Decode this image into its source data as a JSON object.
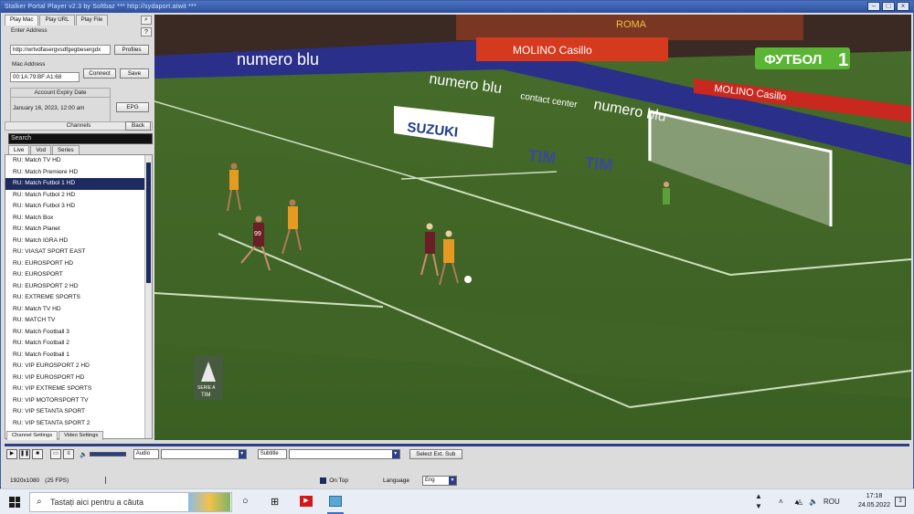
{
  "window": {
    "title": "Stalker Portal Player v2.3 by Soltbaz  ***  http://sydaport.atwit ***",
    "colors": {
      "accent": "#2c4f9c",
      "selection": "#1d2b5e"
    }
  },
  "left_panel": {
    "tabs": [
      "Play Mac",
      "Play URL",
      "Play File"
    ],
    "portal_label": "Enter Address",
    "portal_value": "http://wrtvdfasergvsdfgegbesergdx",
    "profiles_btn": "Profiles",
    "mac_label": "Mac Address",
    "mac_value": "00:1A:79:BF:A1:68",
    "connect_btn": "Connect",
    "save_btn": "Save",
    "expiry_label": "Account Expiry Date",
    "expiry_value": "January 16, 2023, 12:00 am",
    "epg_btn": "EPG",
    "channels_label": "Channels",
    "back_btn": "Back",
    "search_value": "Search",
    "content_tabs": [
      "Live",
      "Vod",
      "Series"
    ],
    "channels": [
      "RU: Match TV HD",
      "RU: Match Premiere HD",
      "RU: Match Futbol 1 HD",
      "RU: Match Futbol 2 HD",
      "RU: Match Futbol 3 HD",
      "RU: Match Box",
      "RU: Match Planet",
      "RU: Match IGRA HD",
      "RU: VIASAT SPORT EAST",
      "RU: EUROSPORT HD",
      "RU: EUROSPORT",
      "RU: EUROSPORT 2 HD",
      "RU: EXTREME SPORTS",
      "RU: Match TV HD",
      "RU: MATCH TV",
      "RU: Match Football 3",
      "RU: Match Football 2",
      "RU: Match Football 1",
      "RU: VIP EUROSPORT 2 HD",
      "RU: VIP EUROSPORT HD",
      "RU: VIP EXTREME SPORTS",
      "RU: VIP MOTORSPORT TV",
      "RU: VIP SETANTA SPORT",
      "RU: VIP SETANTA SPORT 2"
    ],
    "selected_channel_index": 2
  },
  "video": {
    "board_texts": [
      "numero blu",
      "contact center",
      "SUZUKI",
      "TIM",
      "MOLINO Casillo",
      "ROMA"
    ],
    "channel_logo": "ФУТБОЛ",
    "channel_logo_num": "1",
    "league_badge_top": "SERIE A",
    "league_badge_bottom": "TIM",
    "player_number": "99"
  },
  "bottom": {
    "settings_tabs": [
      "Channel Settings",
      "Video Settings"
    ],
    "audio_label": "Audio",
    "subtitle_label": "Subtitle",
    "select_ext_sub_btn": "Select Ext. Sub",
    "resolution": "1920x1080",
    "fps": "(25 FPS)",
    "on_top_label": "On Top",
    "language_label": "Language",
    "language_value": "Eng"
  },
  "taskbar": {
    "search_placeholder": "Tastați aici pentru a căuta",
    "lang": "ROU",
    "time": "17:18",
    "date": "24.05.2022",
    "notif_count": "3"
  }
}
